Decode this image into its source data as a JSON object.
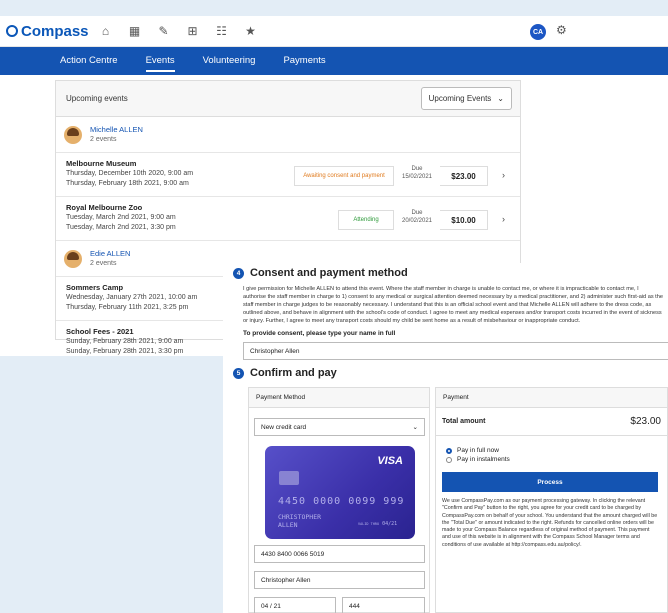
{
  "app": {
    "name": "Compass",
    "avatar_initials": "CA"
  },
  "nav_tabs": [
    "Action Centre",
    "Events",
    "Volunteering",
    "Payments"
  ],
  "upcoming": {
    "title": "Upcoming events",
    "filter": "Upcoming Events",
    "people": [
      {
        "name": "Michelle ALLEN",
        "count": "2 events"
      },
      {
        "name": "Edie ALLEN",
        "count": "2 events"
      }
    ],
    "events": [
      {
        "title": "Melbourne Museum",
        "start": "Thursday, December 10th 2020, 9:00 am",
        "end": "Thursday, February 18th 2021, 9:00 am",
        "status": "Awaiting consent and payment",
        "due_label": "Due",
        "due_date": "15/02/2021",
        "amount": "$23.00"
      },
      {
        "title": "Royal Melbourne Zoo",
        "start": "Tuesday, March 2nd 2021, 9:00 am",
        "end": "Tuesday, March 2nd 2021, 3:30 pm",
        "status": "Attending",
        "due_label": "Due",
        "due_date": "20/02/2021",
        "amount": "$10.00"
      },
      {
        "title": "Sommers Camp",
        "start": "Wednesday, January 27th 2021, 10:00 am",
        "end": "Thursday, February 11th 2021, 3:25 pm"
      },
      {
        "title": "School Fees - 2021",
        "start": "Sunday, February 28th 2021, 9:00 am",
        "end": "Sunday, February 28th 2021, 3:30 pm"
      }
    ]
  },
  "consent": {
    "step": "4",
    "title": "Consent and payment method",
    "text": "I give permission for Michelle ALLEN to attend this event. Where the staff member in charge is unable to contact me, or where it is impracticable to contact me, I authorise the staff member in charge to 1) consent to any medical or surgical attention deemed necessary by a medical practitioner, and 2) administer such first-aid as the staff member in charge judges to be reasonably necessary. I understand that this is an official school event and that Michelle ALLEN will adhere to the dress code, as outlined above, and behave in alignment with the school's code of conduct. I agree to meet any medical expenses and/or transport costs incurred in the event of sickness or injury. Further, I agree to meet any transport costs should my child be sent home as a result of misbehaviour or inappropriate conduct.",
    "label": "To provide consent, please type your name in full",
    "name_value": "Christopher Allen"
  },
  "confirm": {
    "step": "5",
    "title": "Confirm and pay",
    "method_header": "Payment Method",
    "method_select": "New credit card",
    "card": {
      "brand": "VISA",
      "number": "4450 0000 0099 999",
      "holder_line1": "CHRISTOPHER",
      "holder_line2": "ALLEN",
      "exp_label": "VALID THRU",
      "exp": "04/21"
    },
    "card_number_field": "4430 8400 0066 5019",
    "holder_field": "Christopher Allen",
    "expiry_field": "04 / 21",
    "cvv_field": "444",
    "payment_header": "Payment",
    "total_label": "Total amount",
    "total_value": "$23.00",
    "options": [
      "Pay in full now",
      "Pay in instalments"
    ],
    "process_label": "Process",
    "fine_print": "We use CompassPay.com as our payment processing gateway. In clicking the relevant \"Confirm and Pay\" button to the right, you agree for your credit card to be charged by CompassPay.com on behalf of your school. You understand that the amount charged will be the \"Total Due\" or amount indicated to the right. Refunds for cancelled online orders will be made to your Compass Balance regardless of original method of payment. This payment and use of this website is in alignment with the Compass School Manager terms and conditions of use available at http://compass.edu.au/policy/."
  },
  "colors": {
    "primary": "#1454b2",
    "background": "#e3edf6",
    "warning": "#e07b1f",
    "success": "#2e9a3a"
  }
}
